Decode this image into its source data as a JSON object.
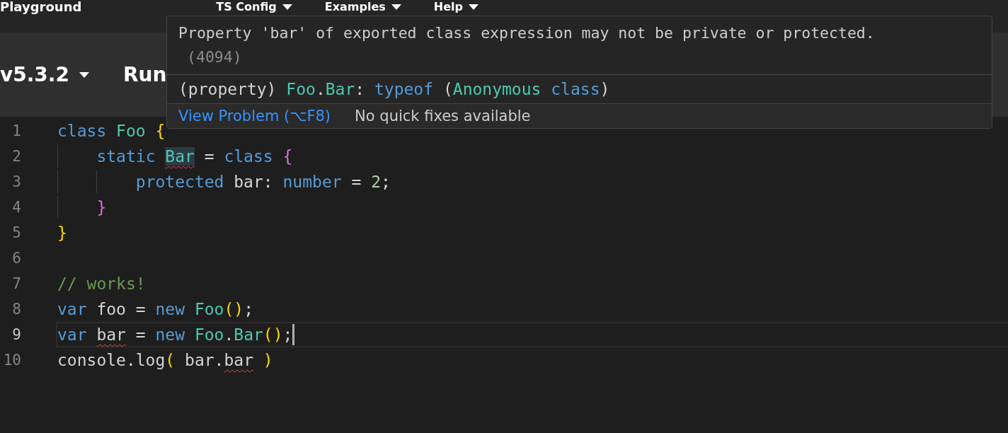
{
  "header": {
    "title": "Playground",
    "menus": [
      {
        "label": "TS Config"
      },
      {
        "label": "Examples"
      },
      {
        "label": "Help"
      }
    ]
  },
  "toolbar": {
    "version": "v5.3.2",
    "run": "Run"
  },
  "editor": {
    "lines": [
      {
        "number": "1",
        "current": false,
        "tokens": [
          {
            "text": "class ",
            "kind": "keyword"
          },
          {
            "text": "Foo ",
            "kind": "type"
          },
          {
            "text": "{",
            "kind": "bracket1"
          }
        ],
        "children": [
          {
            "number": "2",
            "current": false,
            "tokens": [
              {
                "text": "static ",
                "kind": "keyword"
              },
              {
                "text": "Bar",
                "kind": "type",
                "error": true,
                "hovered": true
              },
              {
                "text": " = "
              },
              {
                "text": "class ",
                "kind": "keyword"
              },
              {
                "text": "{",
                "kind": "bracket2"
              }
            ],
            "children": [
              {
                "number": "3",
                "current": false,
                "tokens": [
                  {
                    "text": "protected",
                    "kind": "keyword"
                  },
                  {
                    "text": " bar: "
                  },
                  {
                    "text": "number",
                    "kind": "keyword"
                  },
                  {
                    "text": " = "
                  },
                  {
                    "text": "2",
                    "kind": "number"
                  },
                  {
                    "text": ";"
                  }
                ]
              }
            ]
          },
          {
            "number": "4",
            "current": false,
            "tokens": [
              {
                "text": "}",
                "kind": "bracket2"
              }
            ]
          }
        ]
      },
      {
        "number": "5",
        "current": false,
        "tokens": [
          {
            "text": "}",
            "kind": "bracket1"
          }
        ]
      },
      {
        "number": "6",
        "current": false
      },
      {
        "number": "7",
        "current": false,
        "tokens": [
          {
            "text": "// works!",
            "kind": "comment"
          }
        ]
      },
      {
        "number": "8",
        "current": false,
        "tokens": [
          {
            "text": "var",
            "kind": "keyword"
          },
          {
            "text": " foo = "
          },
          {
            "text": "new ",
            "kind": "keyword"
          },
          {
            "text": "Foo",
            "kind": "type"
          },
          {
            "text": "()",
            "kind": "bracket1"
          },
          {
            "text": ";"
          }
        ]
      },
      {
        "number": "9",
        "current": true,
        "tokens": [
          {
            "text": "var ",
            "kind": "keyword"
          },
          {
            "text": "bar",
            "error": true
          },
          {
            "text": " = "
          },
          {
            "text": "new ",
            "kind": "keyword"
          },
          {
            "text": "Foo",
            "kind": "type"
          },
          {
            "text": "."
          },
          {
            "text": "Bar",
            "kind": "type"
          },
          {
            "text": "()",
            "kind": "bracket1"
          },
          {
            "text": ";"
          }
        ]
      },
      {
        "number": "10",
        "current": false,
        "tokens": [
          {
            "text": "console.log"
          },
          {
            "text": "(",
            "kind": "bracket1"
          },
          {
            "text": " bar."
          },
          {
            "text": "bar",
            "error": true
          },
          {
            "text": " )",
            "kind": "bracket1"
          }
        ]
      }
    ]
  },
  "hover": {
    "message": "Property 'bar' of exported class expression may not be private or protected.",
    "code": "(4094)",
    "signature": [
      {
        "text": "(property) "
      },
      {
        "text": "Foo",
        "kind": "type"
      },
      {
        "text": "."
      },
      {
        "text": "Bar",
        "kind": "type"
      },
      {
        "text": ": "
      },
      {
        "text": "typeof",
        "kind": "keyword"
      },
      {
        "text": " ("
      },
      {
        "text": "Anonymous ",
        "kind": "type"
      },
      {
        "text": "class",
        "kind": "keyword"
      },
      {
        "text": ")"
      }
    ],
    "link": "View Problem (⌥F8)",
    "note": "No quick fixes available"
  }
}
